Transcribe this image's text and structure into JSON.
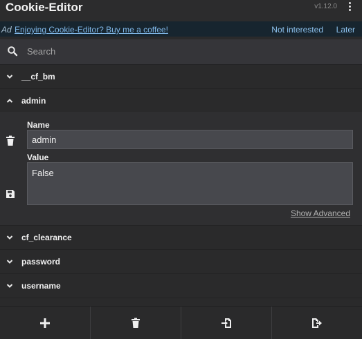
{
  "header": {
    "title": "Cookie-Editor",
    "version": "v1.12.0",
    "menu_icon": "kebab-menu-icon"
  },
  "ad": {
    "tag": "Ad",
    "message": "Enjoying Cookie-Editor? Buy me a coffee!",
    "not_interested": "Not interested",
    "later": "Later"
  },
  "search": {
    "placeholder": "Search",
    "value": "",
    "icon": "search-icon"
  },
  "cookies": [
    {
      "name": "__cf_bm",
      "expanded": false
    },
    {
      "name": "admin",
      "expanded": true
    },
    {
      "name": "cf_clearance",
      "expanded": false
    },
    {
      "name": "password",
      "expanded": false
    },
    {
      "name": "username",
      "expanded": false
    }
  ],
  "editor": {
    "name_label": "Name",
    "name_value": "admin",
    "value_label": "Value",
    "value_value": "False",
    "show_advanced": "Show Advanced",
    "delete_icon": "trash-icon",
    "save_icon": "save-icon"
  },
  "footer": {
    "buttons": [
      "add-icon",
      "delete-all-icon",
      "import-icon",
      "export-icon"
    ]
  },
  "colors": {
    "background": "#2a2a2b",
    "ad_background": "#17252f",
    "link": "#7fb6e6",
    "field_background": "#47484d"
  }
}
